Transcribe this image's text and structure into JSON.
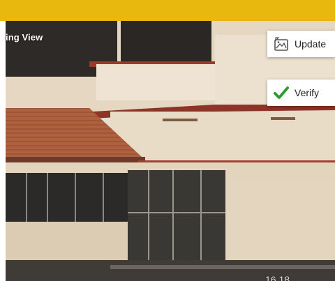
{
  "colors": {
    "top_bar": "#e8b80f",
    "verify_check": "#2e9b2e"
  },
  "overlay": {
    "view_label": "ing View"
  },
  "buttons": {
    "update_label": "Update",
    "update_icon": "image-edit-icon",
    "verify_label": "Verify",
    "verify_icon": "check-icon"
  },
  "footer": {
    "time_text": "16 18"
  }
}
